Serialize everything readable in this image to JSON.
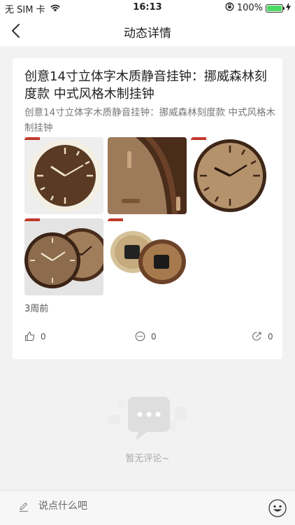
{
  "status_bar": {
    "carrier": "无 SIM 卡",
    "time": "16:13",
    "battery": "100%"
  },
  "nav": {
    "title": "动态详情"
  },
  "post": {
    "title": "创意14寸立体字木质静音挂钟：挪威森林刻度款 中式风格木制挂钟",
    "description": "创意14寸立体字木质静音挂钟：挪威森林刻度款 中式风格木制挂钟",
    "image_icons": [
      "wall-clock-image",
      "clock-side-image",
      "clock-face-image",
      "two-clocks-image",
      "clock-back-image"
    ],
    "time_ago": "3周前",
    "like_count": "0",
    "comment_count": "0",
    "share_count": "0"
  },
  "comments": {
    "empty_text": "暂无评论~"
  },
  "composer": {
    "placeholder": "说点什么吧"
  },
  "colors": {
    "accent_battery": "#4cd964",
    "card_bg": "#ffffff",
    "page_bg": "#f2f2f2"
  }
}
